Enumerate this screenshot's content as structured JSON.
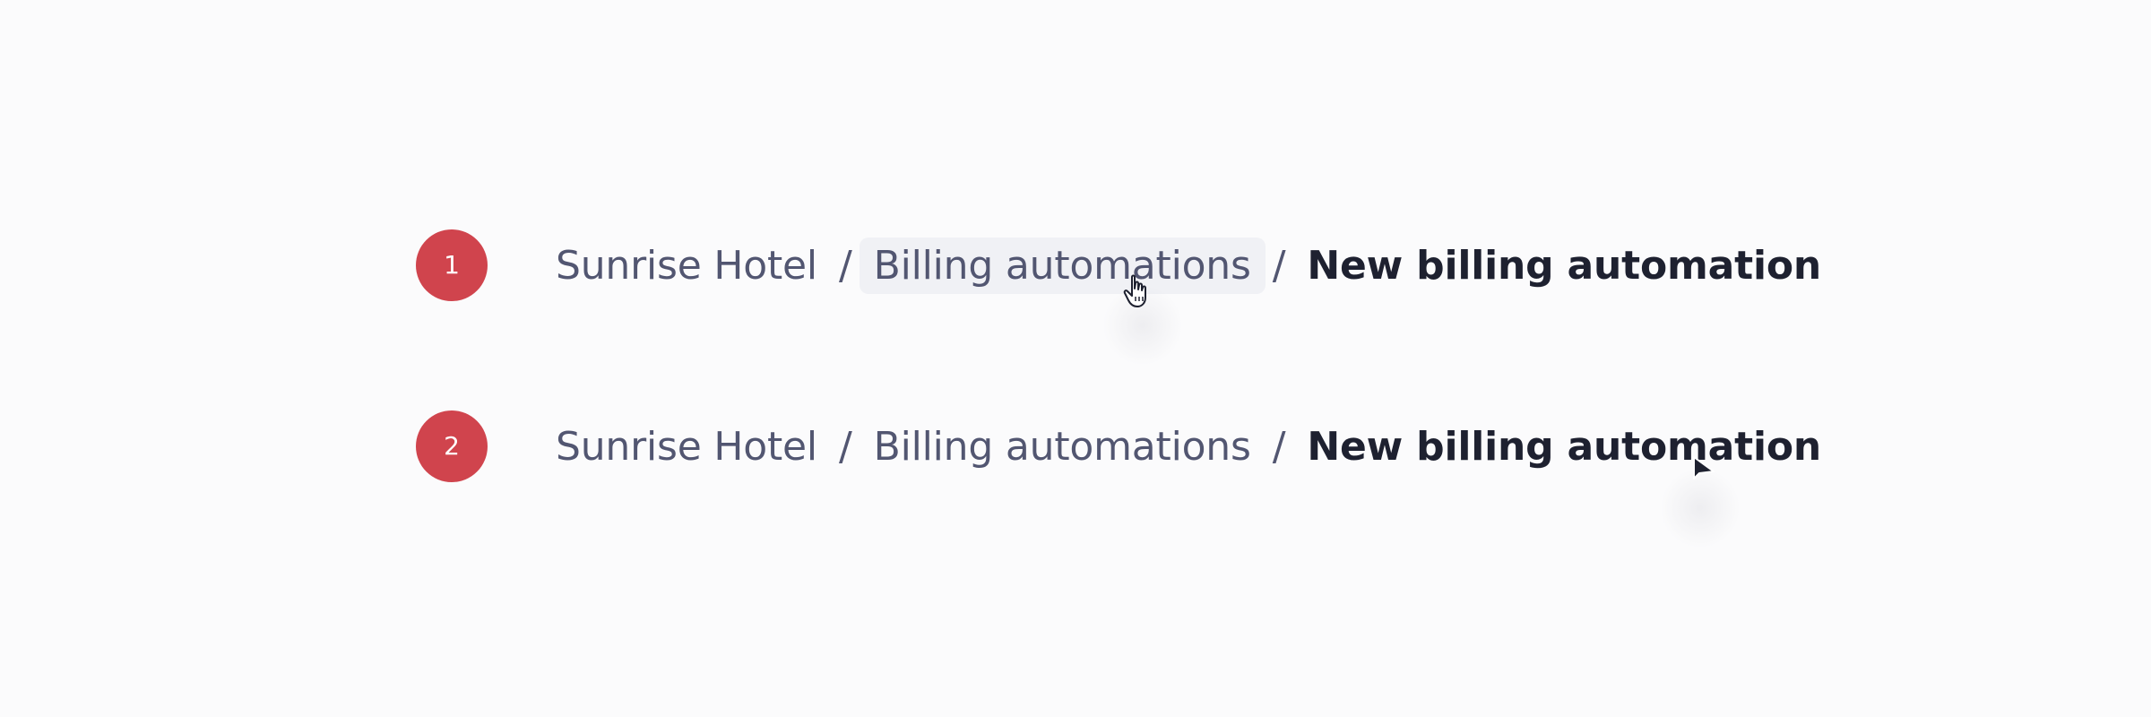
{
  "steps": [
    {
      "number": "1",
      "breadcrumb": {
        "items": [
          "Sunrise Hotel",
          "Billing automations"
        ],
        "separator": "/",
        "current": "New billing automation"
      },
      "hovered_item": "Billing automations",
      "cursor": "hand-pointer"
    },
    {
      "number": "2",
      "breadcrumb": {
        "items": [
          "Sunrise Hotel",
          "Billing automations"
        ],
        "separator": "/",
        "current": "New billing automation"
      },
      "hovered_item": "",
      "cursor": "arrow-pointer"
    }
  ],
  "colors": {
    "background": "#fbfbfc",
    "badge": "#d0444d",
    "link_text": "#525671",
    "current_text": "#1e2130",
    "hover_background": "#f0f1f5"
  }
}
